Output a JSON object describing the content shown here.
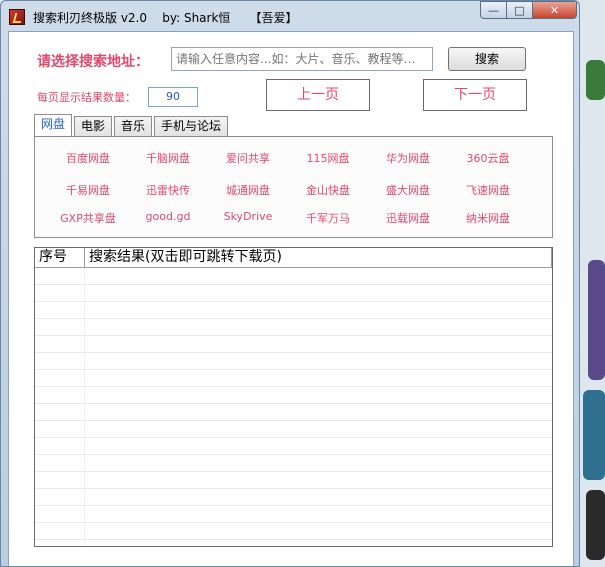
{
  "window": {
    "title": "搜索利刃终极版 v2.0    by: Shark恒     【吾爱】",
    "minimize": "—",
    "maximize": "□",
    "close": "✕"
  },
  "search": {
    "label": "请选择搜索地址：",
    "placeholder": "请输入任意内容...如：大片、音乐、教程等…",
    "button": "搜索"
  },
  "paging": {
    "per_page_label": "每页显示结果数量：",
    "per_page_value": "90",
    "prev": "上一页",
    "next": "下一页"
  },
  "tabs": [
    {
      "label": "网盘",
      "active": true
    },
    {
      "label": "电影",
      "active": false
    },
    {
      "label": "音乐",
      "active": false
    },
    {
      "label": "手机与论坛",
      "active": false
    }
  ],
  "links": [
    "百度网盘",
    "千脑网盘",
    "爱问共享",
    "115网盘",
    "华为网盘",
    "360云盘",
    "千易网盘",
    "迅雷快传",
    "城通网盘",
    "金山快盘",
    "盛大网盘",
    "飞速网盘",
    "GXP共享盘",
    "good.gd",
    "SkyDrive",
    "千军万马",
    "迅载网盘",
    "纳米网盘"
  ],
  "results": {
    "columns": [
      "序号",
      "搜索结果(双击即可跳转下载页)"
    ]
  }
}
